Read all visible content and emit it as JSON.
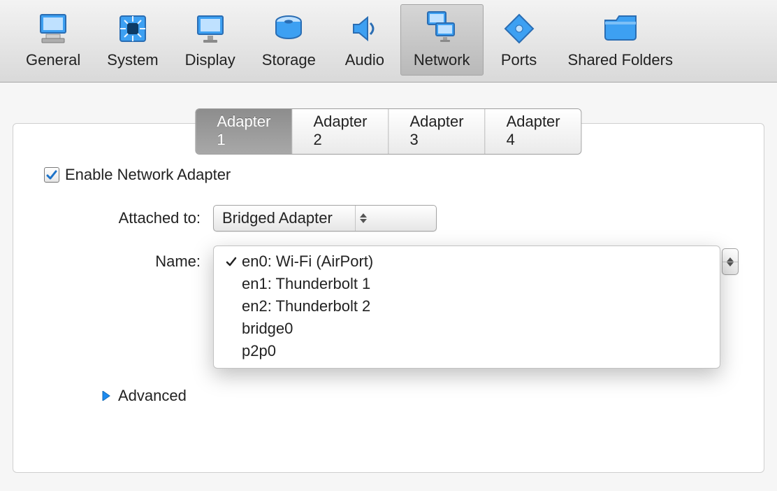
{
  "toolbar": {
    "items": [
      {
        "label": "General"
      },
      {
        "label": "System"
      },
      {
        "label": "Display"
      },
      {
        "label": "Storage"
      },
      {
        "label": "Audio"
      },
      {
        "label": "Network"
      },
      {
        "label": "Ports"
      },
      {
        "label": "Shared Folders"
      }
    ],
    "selected_index": 5
  },
  "tabs": {
    "items": [
      "Adapter 1",
      "Adapter 2",
      "Adapter 3",
      "Adapter 4"
    ],
    "active_index": 0
  },
  "network": {
    "enable_label": "Enable Network Adapter",
    "enable_checked": true,
    "attached_to_label": "Attached to:",
    "attached_to_value": "Bridged Adapter",
    "name_label": "Name:",
    "name_options": [
      "en0: Wi-Fi (AirPort)",
      "en1: Thunderbolt 1",
      "en2: Thunderbolt 2",
      "bridge0",
      "p2p0"
    ],
    "name_selected_index": 0,
    "advanced_label": "Advanced"
  }
}
